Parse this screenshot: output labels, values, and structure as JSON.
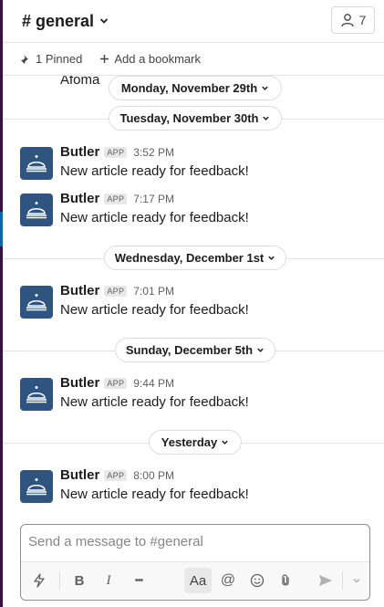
{
  "channel": {
    "title": "# general",
    "member_count": "7"
  },
  "bookmarks": {
    "pinned_label": "1 Pinned",
    "add_label": "Add a bookmark"
  },
  "messages_area": {
    "partial_sender": "Afoma"
  },
  "date_pills": [
    {
      "label": "Monday, November 29th"
    },
    {
      "label": "Tuesday, November 30th"
    },
    {
      "label": "Wednesday, December 1st"
    },
    {
      "label": "Sunday, December 5th"
    },
    {
      "label": "Yesterday"
    }
  ],
  "messages": [
    {
      "sender": "Butler",
      "badge": "APP",
      "time": "3:52 PM",
      "text": "New article ready for feedback!"
    },
    {
      "sender": "Butler",
      "badge": "APP",
      "time": "7:17 PM",
      "text": "New article ready for feedback!"
    },
    {
      "sender": "Butler",
      "badge": "APP",
      "time": "7:01 PM",
      "text": "New article ready for feedback!"
    },
    {
      "sender": "Butler",
      "badge": "APP",
      "time": "9:44 PM",
      "text": "New article ready for feedback!"
    },
    {
      "sender": "Butler",
      "badge": "APP",
      "time": "8:00 PM",
      "text": "New article ready for feedback!"
    }
  ],
  "composer": {
    "placeholder": "Send a message to #general",
    "bold_label": "B",
    "italic_label": "I",
    "more_label": "•••",
    "format_label": "Aa",
    "mention_label": "@"
  },
  "colors": {
    "sidebar": "#3f0e40",
    "avatar": "#2f5480",
    "accent": "#1264a3"
  },
  "icons": [
    "person-icon",
    "pin-icon",
    "plus-icon",
    "chevron-down-icon",
    "bell-icon",
    "lightning-icon",
    "emoji-icon",
    "paperclip-icon",
    "send-icon"
  ]
}
